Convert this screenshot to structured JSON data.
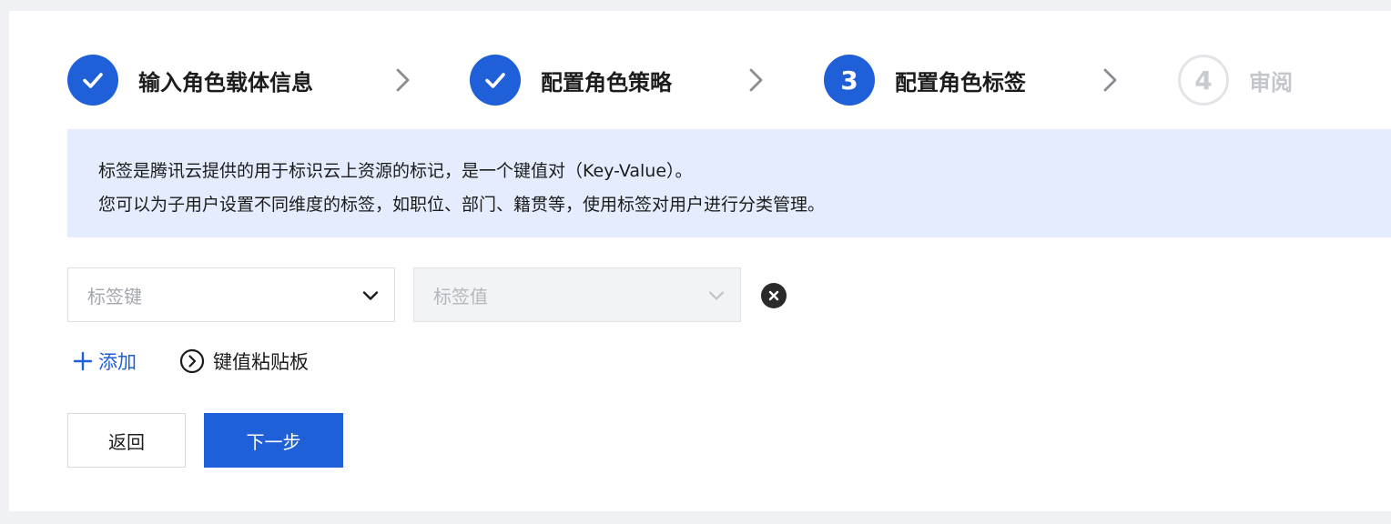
{
  "steps": [
    {
      "label": "输入角色载体信息",
      "state": "done",
      "number": "1"
    },
    {
      "label": "配置角色策略",
      "state": "done",
      "number": "2"
    },
    {
      "label": "配置角色标签",
      "state": "active",
      "number": "3"
    },
    {
      "label": "审阅",
      "state": "pending",
      "number": "4"
    }
  ],
  "info": {
    "line1": "标签是腾讯云提供的用于标识云上资源的标记，是一个键值对（Key-Value）。",
    "line2": "您可以为子用户设置不同维度的标签，如职位、部门、籍贯等，使用标签对用户进行分类管理。"
  },
  "tag_row": {
    "key_placeholder": "标签键",
    "value_placeholder": "标签值"
  },
  "actions": {
    "add_label": "添加",
    "paste_label": "键值粘贴板"
  },
  "buttons": {
    "back_label": "返回",
    "next_label": "下一步"
  },
  "colors": {
    "primary": "#1f5fd8",
    "info_bg": "#e4ecfd",
    "pending": "#c4c6cc"
  },
  "icons": {
    "check": "check-icon",
    "chevron_right": "chevron-right-icon",
    "chevron_down": "chevron-down-icon",
    "close": "close-circle-icon",
    "plus": "plus-icon",
    "circle_chevron": "circle-chevron-right-icon"
  }
}
